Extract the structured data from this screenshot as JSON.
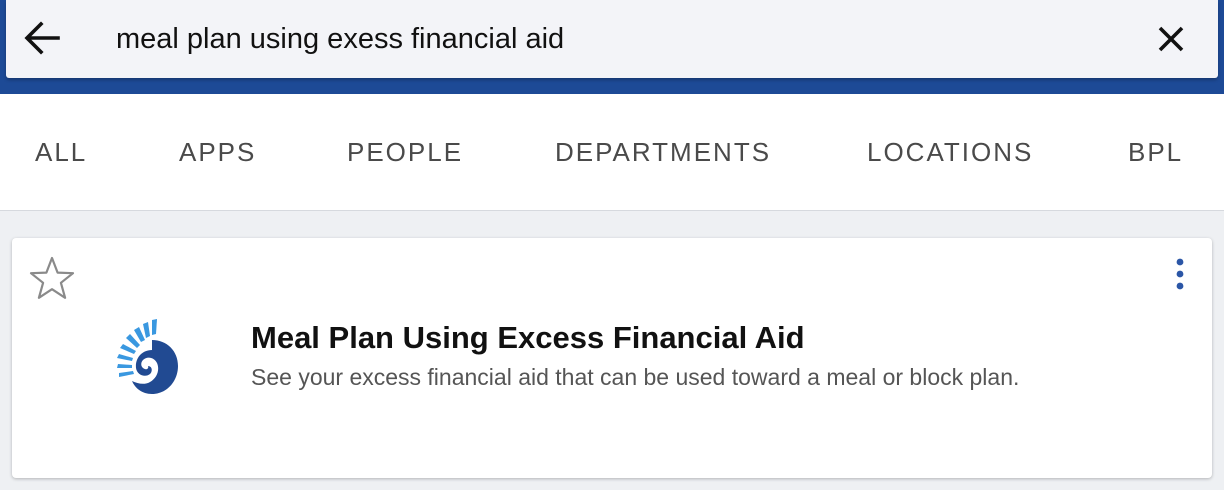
{
  "search": {
    "query": "meal plan using exess financial aid",
    "back_icon": "arrow-left-icon",
    "clear_icon": "close-icon"
  },
  "tabs": [
    {
      "label": "ALL"
    },
    {
      "label": "APPS"
    },
    {
      "label": "PEOPLE"
    },
    {
      "label": "DEPARTMENTS"
    },
    {
      "label": "LOCATIONS"
    },
    {
      "label": "BPL"
    }
  ],
  "results": [
    {
      "title": "Meal Plan Using Excess Financial Aid",
      "description": "See your excess financial aid that can be used toward a meal or block plan.",
      "favorite_icon": "star-outline-icon",
      "menu_icon": "more-vertical-icon",
      "logo": "nautilus-logo"
    }
  ],
  "colors": {
    "header_blue": "#1d4a96",
    "kebab_blue": "#2b56a6",
    "logo_light_blue": "#3a98e0",
    "logo_dark_blue": "#214a92"
  }
}
